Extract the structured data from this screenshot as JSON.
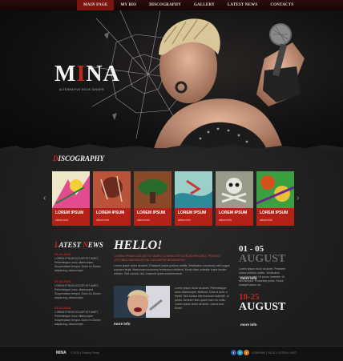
{
  "nav": {
    "items": [
      {
        "label": "MAIN PAGE"
      },
      {
        "label": "MY BIO"
      },
      {
        "label": "DISCOGRAPHY"
      },
      {
        "label": "GALLERY"
      },
      {
        "label": "LATEST NEWS"
      },
      {
        "label": "CONTACTS"
      }
    ]
  },
  "hero": {
    "logo_pre": "M",
    "logo_i": "I",
    "logo_post": "NA",
    "tagline": "ALTERNATIVE ROCK SINGER"
  },
  "discography": {
    "title_first": "D",
    "title_rest": "ISCOGRAPHY",
    "prev_arrow": "‹",
    "next_arrow": "›",
    "albums": [
      {
        "title": "LOREM IPSUM",
        "sub": "album info",
        "c1": "#e24b8e",
        "c2": "#f3d03b"
      },
      {
        "title": "LOREM IPSUM",
        "sub": "album info",
        "c1": "#6b2a1e",
        "c2": "#b9543a"
      },
      {
        "title": "LOREM IPSUM",
        "sub": "album info",
        "c1": "#2a6a2a",
        "c2": "#8a4a2a"
      },
      {
        "title": "LOREM IPSUM",
        "sub": "album info",
        "c1": "#2c8a9a",
        "c2": "#9ad0c8"
      },
      {
        "title": "LOREM IPSUM",
        "sub": "album info",
        "c1": "#4a4a3a",
        "c2": "#9a9a8a"
      },
      {
        "title": "LOREM IPSUM",
        "sub": "album info",
        "c1": "#d4501c",
        "c2": "#3aa040"
      }
    ]
  },
  "news": {
    "title_first": "L",
    "title_mid": "ATEST ",
    "title_second": "N",
    "title_rest": "EWS",
    "items": [
      {
        "date": "01.01.2013",
        "text": "LOREM IPSUM DOLOR SIT AMET, Pellentesque nunc ullamcorper. Suspendisse tempor. Dolor eu Donec adipiscing, ullamcorper."
      },
      {
        "date": "01.01.2013",
        "text": "LOREM IPSUM DOLOR SIT AMET, Pellentesque nunc ullamcorper. Suspendisse tempor. Dolor eu Donec adipiscing, ullamcorper."
      },
      {
        "date": "01.01.2013",
        "text": "LOREM IPSUM DOLOR SIT AMET, Pellentesque nunc ullamcorper. Suspendisse tempor. Dolor eu Donec adipiscing, ullamcorper."
      }
    ]
  },
  "hello": {
    "title": "HELLO!",
    "lead": "LOREM IPSUM DOLOR SIT AMET, CONSECTETUER ADIPISCING. PROENT VESTIBULUM MOLESTIE LACUSENE AENEAN NO",
    "body": "Lorem ipsum dolor sit amet. Praesent luctus pretium mattis. Vestibulum nonummy velit augue, posuere ferjat. Maecenas nonummy fermentum eleifend. Morbi vitae molestie turpis lacinia ultrices. Sed cursus, nisi, euismod quam condimentum.",
    "body2": "Lorem ipsum dolor sit amet. Pellentesque nunc ullamcorper, eleifend. Cras et dolor a Morbi. Sed cursus nisi euismod molestie, ut purus. Aenean risus quam nunc eu nulla. Lorem ipsum dolor sit amet, cursus sed. Morbi.",
    "more": "more info"
  },
  "events": [
    {
      "dates": "01 - 05",
      "month": "AUGUST",
      "text": "Lorem ipsum dolor sit amet. Praesent luctus pretium mattis. Vestibulum nonummy velit. Ut purus molestie. Ut sed tempus. Phasellus porta. Fusce suscipit varius mi.",
      "more": "more info"
    },
    {
      "dates": "18-25",
      "month": "AUGUST",
      "text": "",
      "more": "more info"
    }
  ],
  "footer": {
    "name": "MINA",
    "copy": "© 2013 | Privacy Policy",
    "links": "COMPANY  |  FACE  |  LISTEN  |  VISIT",
    "social": [
      {
        "name": "facebook",
        "color": "#3a5a9a",
        "glyph": "f"
      },
      {
        "name": "twitter",
        "color": "#2aa0d8",
        "glyph": "t"
      },
      {
        "name": "rss",
        "color": "#e07a20",
        "glyph": "r"
      }
    ]
  },
  "colors": {
    "accent": "#b52117"
  }
}
